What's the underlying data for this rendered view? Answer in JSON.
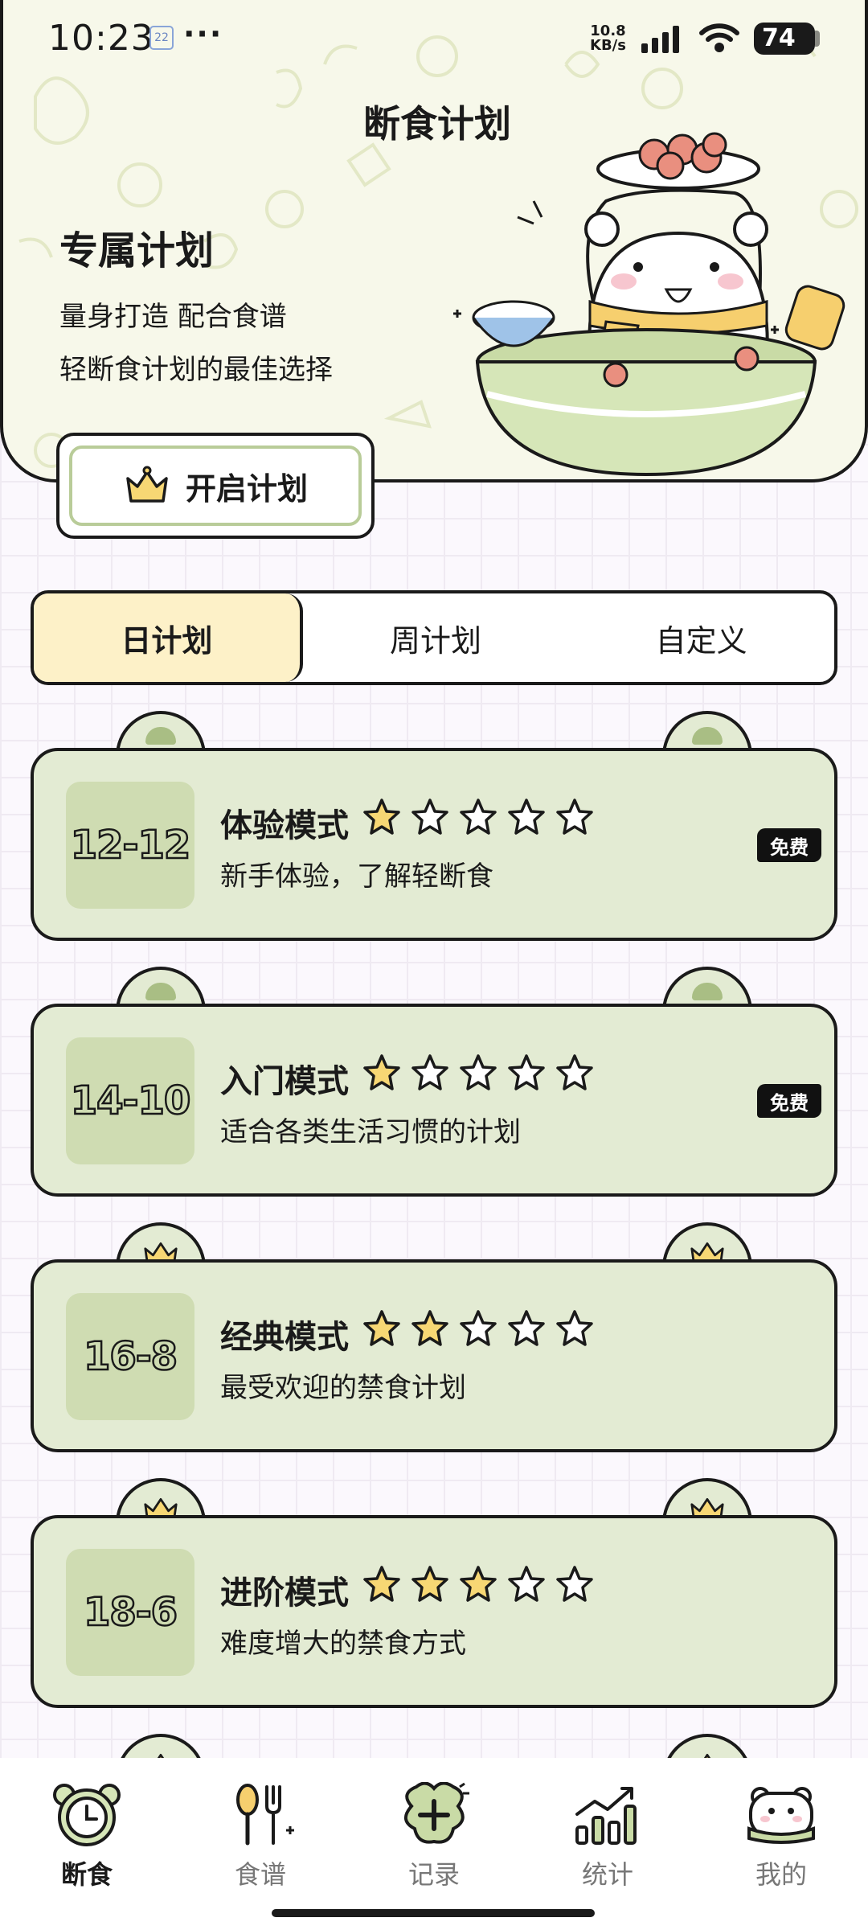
{
  "status_bar": {
    "time": "10:23",
    "calendar_badge": "22",
    "more": "···",
    "speed_value": "10.8",
    "speed_unit": "KB/s",
    "battery": "74"
  },
  "header": {
    "title": "断食计划",
    "plan_title": "专属计划",
    "plan_subtitle_1": "量身打造 配合食谱",
    "plan_subtitle_2": "轻断食计划的最佳选择",
    "start_button": "开启计划"
  },
  "tabs": [
    {
      "label": "日计划",
      "active": true
    },
    {
      "label": "周计划",
      "active": false
    },
    {
      "label": "自定义",
      "active": false
    }
  ],
  "plans": [
    {
      "ratio": "12-12",
      "title": "体验模式",
      "filled_stars": 1,
      "total_stars": 5,
      "desc": "新手体验，了解轻断食",
      "badge": "免费",
      "ear": "dot"
    },
    {
      "ratio": "14-10",
      "title": "入门模式",
      "filled_stars": 1,
      "total_stars": 5,
      "desc": "适合各类生活习惯的计划",
      "badge": "免费",
      "ear": "dot"
    },
    {
      "ratio": "16-8",
      "title": "经典模式",
      "filled_stars": 2,
      "total_stars": 5,
      "desc": "最受欢迎的禁食计划",
      "badge": "",
      "ear": "crown"
    },
    {
      "ratio": "18-6",
      "title": "进阶模式",
      "filled_stars": 3,
      "total_stars": 5,
      "desc": "难度增大的禁食方式",
      "badge": "",
      "ear": "crown"
    }
  ],
  "nav": [
    {
      "label": "断食",
      "icon": "clock-icon",
      "active": true
    },
    {
      "label": "食谱",
      "icon": "utensils-icon",
      "active": false
    },
    {
      "label": "记录",
      "icon": "add-record-icon",
      "active": false
    },
    {
      "label": "统计",
      "icon": "stats-icon",
      "active": false
    },
    {
      "label": "我的",
      "icon": "profile-bear-icon",
      "active": false
    }
  ],
  "colors": {
    "card_green": "#e3ebd3",
    "ratio_green": "#cfdcb2",
    "accent_yellow": "#fdf1c8",
    "star_yellow": "#f7d774",
    "header_bg": "#f7f8ea"
  }
}
